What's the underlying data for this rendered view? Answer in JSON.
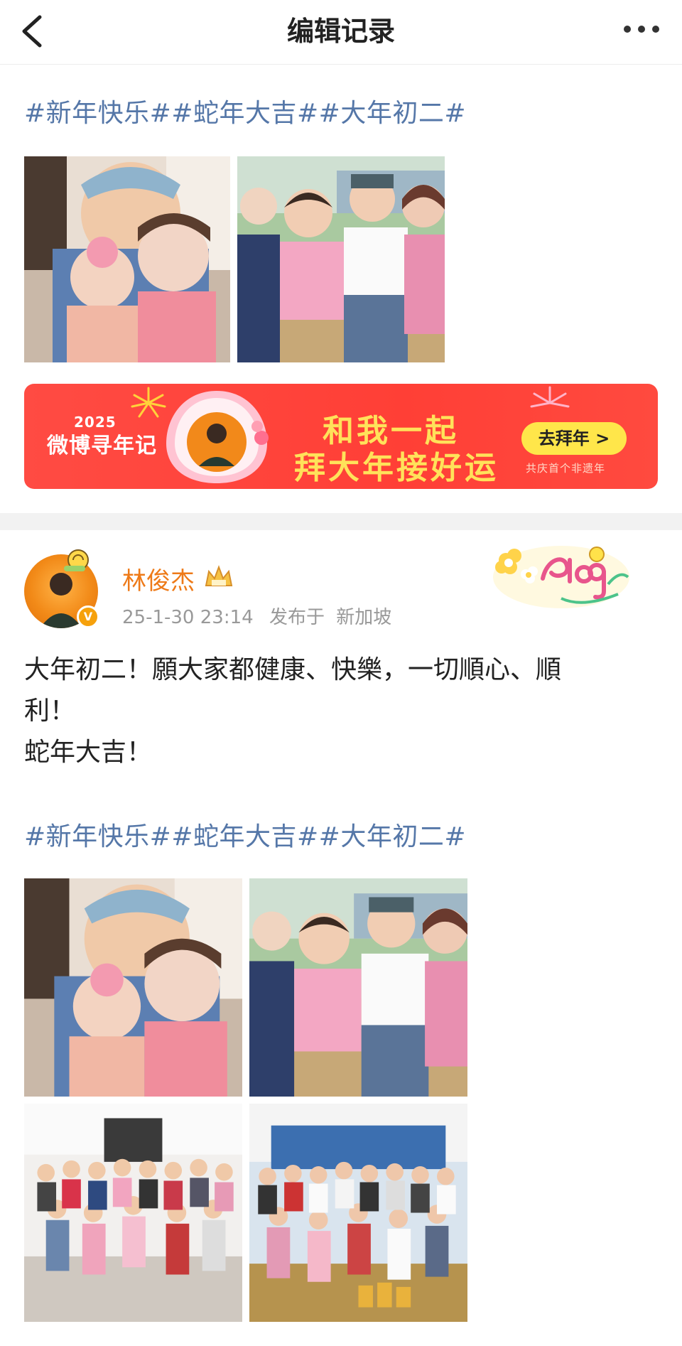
{
  "nav": {
    "title": "编辑记录",
    "back_icon": "back-chevron-icon",
    "more_icon": "more-dots-icon"
  },
  "edit_version": {
    "hashtags": "#新年快乐##蛇年大吉##大年初二#",
    "photos": [
      "family-photo-1",
      "family-photo-2"
    ]
  },
  "banner": {
    "year": "2025",
    "brand": "微博寻年记",
    "line1": "和我一起",
    "line2": "拜大年接好运",
    "button": "去拜年 >",
    "subtitle": "共庆首个非遗年"
  },
  "post": {
    "user_name": "林俊杰",
    "verified": "V",
    "timestamp": "25-1-30 23:14",
    "location_prefix": "发布于",
    "location": "新加坡",
    "text": "大年初二！願大家都健康、快樂，一切順心、順\n利！\n蛇年大吉！",
    "hashtags": "#新年快乐##蛇年大吉##大年初二#",
    "photos": [
      "family-photo-1",
      "family-photo-2",
      "family-photo-3",
      "family-photo-4"
    ]
  },
  "colors": {
    "hashtag": "#5577a8",
    "username": "#ee7a18",
    "banner_red": "#ff4b43",
    "banner_text": "#ffe25a",
    "button_yellow": "#ffe64a"
  }
}
